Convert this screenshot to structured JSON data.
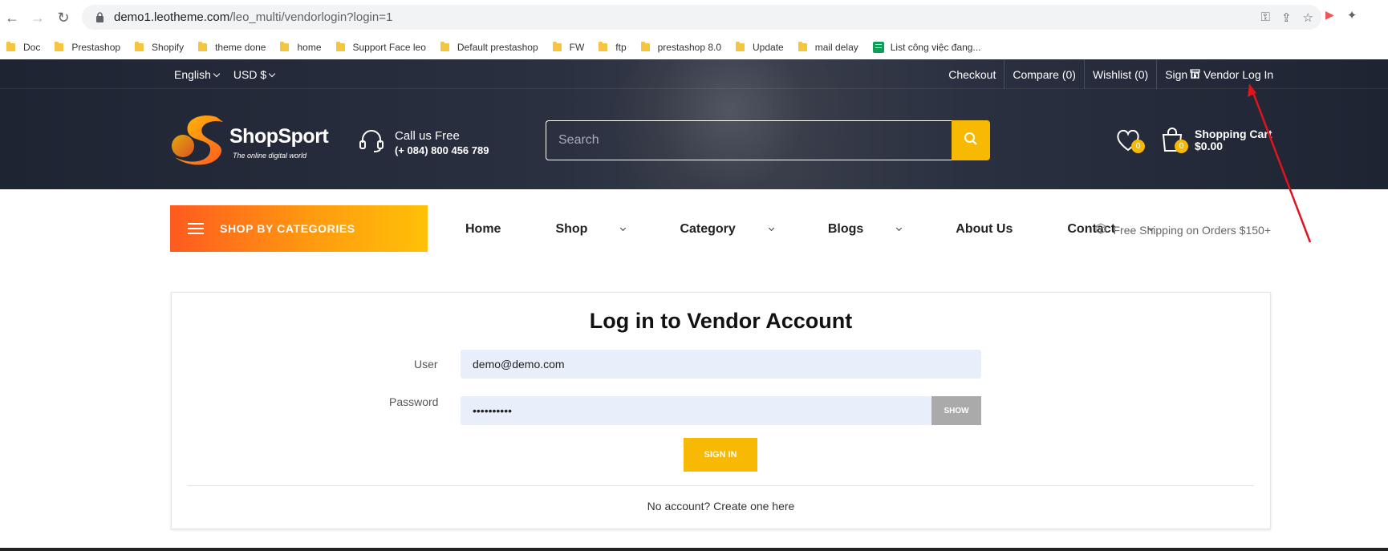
{
  "browser": {
    "url_host": "demo1.leotheme.com",
    "url_path": "/leo_multi/vendorlogin?login=1",
    "bookmarks": [
      "Doc",
      "Prestashop",
      "Shopify",
      "theme done",
      "home",
      "Support Face leo",
      "Default prestashop",
      "FW",
      "ftp",
      "prestashop 8.0",
      "Update",
      "mail delay",
      "List công việc đang..."
    ]
  },
  "topbar": {
    "language": "English",
    "currency": "USD $",
    "links": [
      "Checkout",
      "Compare (0)",
      "Wishlist (0)",
      "Sign in"
    ],
    "vendor_login": "Vendor Log In"
  },
  "header": {
    "logo_name": "ShopSport",
    "logo_tagline": "The online digital world",
    "call_label": "Call us Free",
    "call_number": "(+ 084) 800 456 789",
    "search_placeholder": "Search",
    "wishlist_count": "0",
    "cart_count": "0",
    "cart_label": "Shopping Cart",
    "cart_total": "$0.00"
  },
  "nav": {
    "categories_button": "SHOP BY CATEGORIES",
    "items": [
      "Home",
      "Shop",
      "Category",
      "Blogs",
      "About Us",
      "Contact"
    ],
    "free_shipping": "Free Shipping on Orders $150+"
  },
  "login": {
    "title": "Log in to Vendor Account",
    "user_label": "User",
    "user_value": "demo@demo.com",
    "password_label": "Password",
    "password_value": "••••••••••",
    "show_button": "SHOW",
    "signin_button": "SIGN IN",
    "no_account": "No account? Create one here"
  },
  "colors": {
    "accent": "#f7b903",
    "header_bg": "#1e2432",
    "annotation_arrow": "#e0141e"
  }
}
